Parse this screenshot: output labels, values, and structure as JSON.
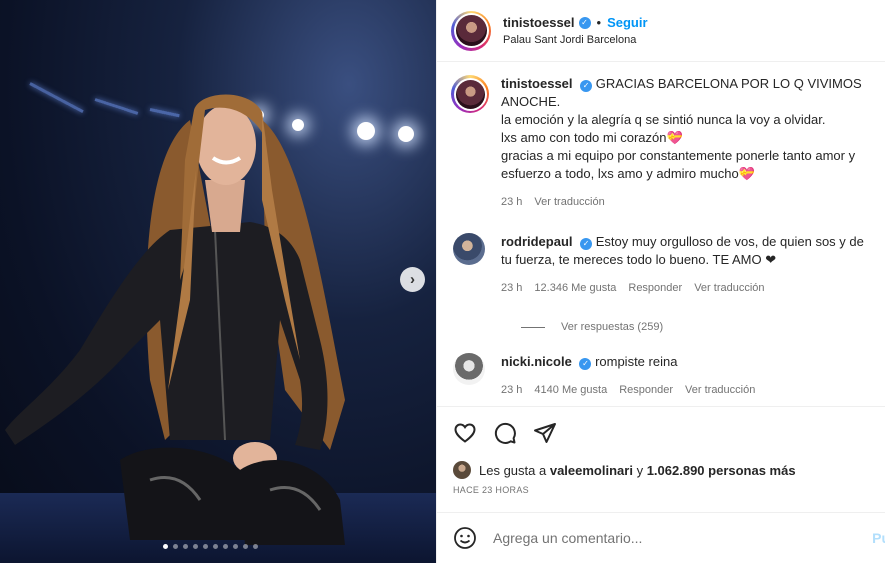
{
  "header": {
    "username": "tinistoessel",
    "separator": "•",
    "follow_label": "Seguir",
    "location": "Palau Sant Jordi Barcelona"
  },
  "caption": {
    "username": "tinistoessel",
    "line1": "GRACIAS BARCELONA POR LO Q VIVIMOS ANOCHE.",
    "line2": "la emoción y la alegría q se sintió nunca la voy a olvidar.",
    "line3": "lxs amo con todo mi corazón💝",
    "line4": "gracias a mi equipo por constantemente ponerle tanto amor y esfuerzo a todo, lxs amo y admiro mucho💝",
    "time": "23 h",
    "translate": "Ver traducción"
  },
  "comments": [
    {
      "username": "rodridepaul",
      "text": "Estoy muy orgulloso de vos, de quien sos y de tu fuerza, te mereces todo lo bueno. TE AMO ❤",
      "time": "23 h",
      "likes": "12.346 Me gusta",
      "reply": "Responder",
      "translate": "Ver traducción",
      "replies": "Ver respuestas (259)"
    },
    {
      "username": "nicki.nicole",
      "text": "rompiste reina",
      "time": "23 h",
      "likes": "4140 Me gusta",
      "reply": "Responder",
      "translate": "Ver traducción"
    }
  ],
  "likes": {
    "prefix": "Les gusta a",
    "user": "valeemolinari",
    "connector": "y",
    "count": "1.062.890 personas más"
  },
  "posted": "HACE 23 HORAS",
  "add_comment": {
    "placeholder": "Agrega un comentario...",
    "publish": "Pu"
  },
  "icons": {
    "like": "heart-icon",
    "comment": "comment-icon",
    "share": "send-icon",
    "emoji": "smiley-icon",
    "next": "chevron-right-icon",
    "verified": "verified-badge-icon"
  },
  "carousel": {
    "total": 10,
    "active": 1
  },
  "colors": {
    "accent": "#0095f6",
    "verified": "#3897f0",
    "muted": "#737373"
  }
}
